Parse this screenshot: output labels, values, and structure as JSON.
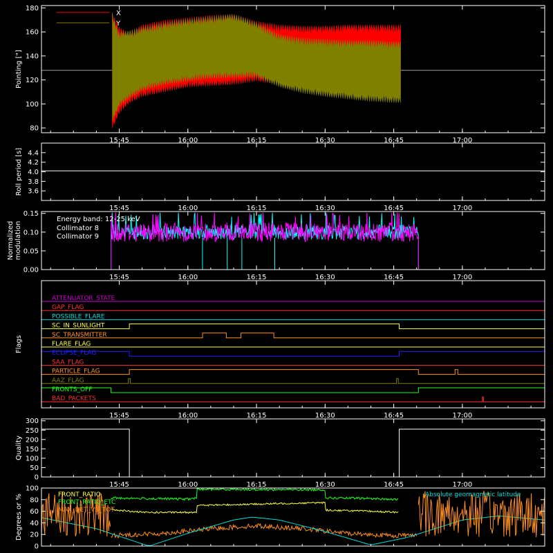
{
  "chart_data": [
    {
      "id": "pointing",
      "type": "area",
      "ylabel": "Pointing [\"]",
      "ylim": [
        76,
        182
      ],
      "yticks": [
        80,
        100,
        120,
        140,
        160,
        180
      ],
      "xticks": [
        "15:45",
        "16:00",
        "16:15",
        "16:30",
        "16:45",
        "17:00"
      ],
      "reference_level": 128,
      "legend": [
        {
          "name": "X",
          "color": "#ff0000"
        },
        {
          "name": "Y",
          "color": "#808000"
        }
      ],
      "series": [
        {
          "name": "X",
          "color": "#ff0000",
          "t": [
            "15:43.5",
            "15:44",
            "15:45",
            "15:47",
            "15:50",
            "15:55",
            "16:00",
            "16:05",
            "16:10",
            "16:15",
            "16:20",
            "16:25",
            "16:30",
            "16:35",
            "16:40",
            "16:45",
            "16:46.5"
          ],
          "upper": [
            176,
            172,
            164,
            160,
            166,
            170,
            172,
            174,
            175,
            169,
            166,
            165,
            165,
            166,
            166,
            166,
            166
          ],
          "lower": [
            80,
            83,
            92,
            100,
            106,
            110,
            114,
            115,
            116,
            119,
            116,
            113,
            112,
            111,
            110,
            110,
            110
          ]
        },
        {
          "name": "Y",
          "color": "#808000",
          "t": [
            "15:43.5",
            "15:44",
            "15:45",
            "15:47",
            "15:50",
            "15:55",
            "16:00",
            "16:05",
            "16:10",
            "16:15",
            "16:20",
            "16:25",
            "16:30",
            "16:35",
            "16:40",
            "16:45",
            "16:46.5"
          ],
          "upper": [
            176,
            169,
            160,
            161,
            164,
            168,
            171,
            173,
            175,
            168,
            158,
            155,
            154,
            153,
            153,
            152,
            152
          ],
          "lower": [
            86,
            90,
            98,
            104,
            111,
            116,
            119,
            121,
            122,
            122,
            114,
            109,
            106,
            104,
            102,
            101,
            101
          ]
        }
      ]
    },
    {
      "id": "roll",
      "type": "line",
      "ylabel": "Roll period [s]",
      "ylim": [
        3.4,
        4.6
      ],
      "yticks": [
        "3.6",
        "3.8",
        "4.0",
        "4.2",
        "4.4"
      ],
      "xticks": [
        "15:45",
        "16:00",
        "16:15",
        "16:30",
        "16:45",
        "17:00"
      ],
      "series": [
        {
          "color": "#ffffff",
          "t": [
            "15:28",
            "17:18"
          ],
          "values": [
            4.02,
            4.02
          ]
        }
      ]
    },
    {
      "id": "modulation",
      "type": "line",
      "ylabel": "Normalized modulation",
      "ylim": [
        0,
        0.155
      ],
      "yticks": [
        "0.00",
        "0.05",
        "0.10",
        "0.15"
      ],
      "xticks": [
        "15:45",
        "16:00",
        "16:15",
        "16:30",
        "16:45",
        "17:00"
      ],
      "annotation": "Energy band: 12-25 keV",
      "legend": [
        {
          "name": "Collimator 8",
          "color": "#00ffff"
        },
        {
          "name": "Collimator 9",
          "color": "#ff00ff"
        }
      ],
      "series": [
        {
          "name": "Collimator 8",
          "color": "#00ffff",
          "t_start": "15:43.2",
          "t_end": "16:50.4",
          "mean": 0.1,
          "spread": 0.022,
          "dropouts": [
            "16:03.2",
            "16:08.6",
            "16:11.8",
            "16:19.0"
          ]
        },
        {
          "name": "Collimator 9",
          "color": "#ff00ff",
          "t_start": "15:43.2",
          "t_end": "16:50.4",
          "mean": 0.1,
          "spread": 0.026
        }
      ]
    },
    {
      "id": "flags",
      "type": "line",
      "ylabel": "Flags",
      "xticks": [
        "15:45",
        "16:00",
        "16:15",
        "16:30",
        "16:45",
        "17:00"
      ],
      "flags": [
        {
          "label": "ATTENUATOR_STATE",
          "color": "#cc00cc",
          "segments": [
            [
              "15:28",
              0,
              "17:18"
            ]
          ]
        },
        {
          "label": "GAP_FLAG",
          "color": "#ff3030",
          "segments": [
            [
              "15:28",
              0,
              "17:18"
            ]
          ]
        },
        {
          "label": "POSSIBLE_FLARE",
          "color": "#00dddd",
          "segments": [
            [
              "15:28",
              0,
              "17:18"
            ]
          ]
        },
        {
          "label": "SC_IN_SUNLIGHT",
          "color": "#ffff40",
          "segments": [
            [
              "15:28",
              0,
              "15:47.2"
            ],
            [
              "15:47.2",
              1,
              "16:46.2"
            ],
            [
              "16:46.2",
              0,
              "17:18"
            ]
          ]
        },
        {
          "label": "SC_TRANSMITTER",
          "color": "#ff9020",
          "segments": [
            [
              "15:28",
              0,
              "16:03.2"
            ],
            [
              "16:03.2",
              1,
              "16:08.4"
            ],
            [
              "16:08.4",
              0,
              "16:11.6"
            ],
            [
              "16:11.6",
              1,
              "16:18.8"
            ],
            [
              "16:18.8",
              0,
              "17:18"
            ]
          ]
        },
        {
          "label": "FLARE_FLAG",
          "color": "#ffff40",
          "segments": [
            [
              "15:28",
              0,
              "17:18"
            ]
          ]
        },
        {
          "label": "ECLIPSE_FLAG",
          "color": "#2020ff",
          "segments": [
            [
              "15:28",
              1,
              "15:47.2"
            ],
            [
              "15:47.2",
              0,
              "16:46.2"
            ],
            [
              "16:46.2",
              1,
              "17:18"
            ]
          ]
        },
        {
          "label": "SAA_FLAG",
          "color": "#ff3030",
          "segments": [
            [
              "15:28",
              0,
              "17:18"
            ]
          ]
        },
        {
          "label": "PARTICLE_FLAG",
          "color": "#ff9020",
          "segments": [
            [
              "15:28",
              0,
              "15:47.2"
            ],
            [
              "15:47.2",
              1,
              "16:50.4"
            ],
            [
              "16:50.4",
              0,
              "16:53.0"
            ],
            [
              "16:53.0",
              0,
              "16:57.6"
            ],
            [
              "16:57.6",
              0,
              "16:58.4"
            ],
            [
              "16:58.4",
              1,
              "16:59.0"
            ],
            [
              "16:59.0",
              0,
              "17:18"
            ]
          ]
        },
        {
          "label": "AAZ_FLAG",
          "color": "#808000",
          "segments": [
            [
              "15:28",
              0,
              "15:47.0"
            ],
            [
              "15:47.0",
              1,
              "15:47.4"
            ],
            [
              "15:47.4",
              0,
              "16:45.6"
            ],
            [
              "16:45.6",
              1,
              "16:46.0"
            ],
            [
              "16:46.0",
              0,
              "17:18"
            ]
          ]
        },
        {
          "label": "FRONTS_OFF",
          "color": "#20ff20",
          "segments": [
            [
              "15:28",
              1,
              "15:43.2"
            ],
            [
              "15:43.2",
              0,
              "16:50.4"
            ],
            [
              "16:50.4",
              1,
              "17:18"
            ]
          ]
        },
        {
          "label": "BAD_PACKETS",
          "color": "#ff3030",
          "segments": [
            [
              "15:28",
              0,
              "17:04.4"
            ],
            [
              "17:04.4",
              1,
              "17:04.6"
            ],
            [
              "17:04.6",
              0,
              "17:18"
            ]
          ]
        }
      ]
    },
    {
      "id": "quality",
      "type": "line",
      "ylabel": "Quality",
      "ylim": [
        0,
        310
      ],
      "yticks": [
        0,
        50,
        100,
        150,
        200,
        250,
        300
      ],
      "xticks": [
        "15:45",
        "16:00",
        "16:15",
        "16:30",
        "16:45",
        "17:00"
      ],
      "series": [
        {
          "color": "#ffffff",
          "t": [
            "15:28",
            "15:47.2",
            "15:47.2",
            "16:46.2",
            "16:46.2",
            "17:18"
          ],
          "values": [
            255,
            255,
            0,
            0,
            255,
            255
          ]
        }
      ]
    },
    {
      "id": "geomag",
      "type": "line",
      "ylabel": "Degrees or %",
      "ylim": [
        0,
        100
      ],
      "yticks": [
        0,
        20,
        40,
        60,
        80,
        100
      ],
      "legend": [
        {
          "name": "FRONT_RATIO",
          "color": "#ffff40"
        },
        {
          "name": "FRONT_RATIO_ETC",
          "color": "#20ff20"
        },
        {
          "name": "MAX_DET_VS_TOT",
          "color": "#ff9020"
        }
      ],
      "label_right": "Absolute geomagnetic latitude",
      "label_right_color": "#00dddd",
      "series": [
        {
          "name": "FRONT_RATIO",
          "color": "#ffff40",
          "t": [
            "15:43.2",
            "15:50",
            "16:00",
            "16:02",
            "16:02",
            "16:30",
            "16:30",
            "16:40",
            "16:46"
          ],
          "values": [
            63,
            58,
            58,
            59,
            70,
            75,
            62,
            60,
            58
          ]
        },
        {
          "name": "FRONT_RATIO_ETC",
          "color": "#20ff20",
          "t": [
            "15:43.2",
            "15:50",
            "16:00",
            "16:02",
            "16:02",
            "16:30",
            "16:30",
            "16:40",
            "16:46"
          ],
          "values": [
            83,
            82,
            81,
            83,
            98,
            97,
            83,
            82,
            80
          ]
        },
        {
          "name": "MAX_DET_VS_TOT",
          "color": "#ff9020",
          "t": [
            "15:43.2",
            "15:55",
            "16:05",
            "16:15",
            "16:25",
            "16:35",
            "16:45",
            "16:50"
          ],
          "values": [
            18,
            22,
            30,
            35,
            30,
            22,
            18,
            20
          ]
        },
        {
          "name": "Absolute geomagnetic latitude",
          "color": "#00dddd",
          "t": [
            "15:28",
            "15:40",
            "15:51.5",
            "16:00",
            "16:10",
            "16:14",
            "16:20",
            "16:30",
            "16:40",
            "16:48",
            "17:00",
            "17:08",
            "17:18"
          ],
          "values": [
            49,
            30,
            0,
            22,
            45,
            50,
            45,
            25,
            2,
            15,
            45,
            52,
            45
          ]
        }
      ]
    }
  ]
}
